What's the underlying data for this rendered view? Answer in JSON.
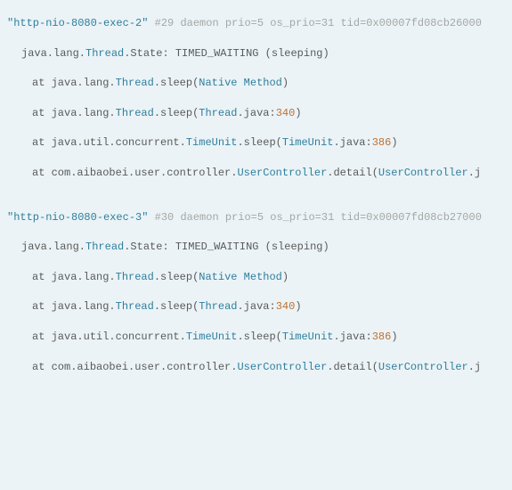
{
  "threads": [
    {
      "name_quoted": "\"http-nio-8080-exec-2\"",
      "meta": "#29 daemon prio=5 os_prio=31 tid=0x00007fd08cb26000",
      "state_prefix_pkg": "java.lang.",
      "state_prefix_cls": "Thread",
      "state_prefix_tail": ".State:",
      "state_value": "TIMED_WAITING (sleeping)",
      "frames": [
        {
          "at": "at ",
          "pkg": "java.lang.",
          "cls": "Thread",
          "method": ".sleep",
          "open": "(",
          "file": "Native Method",
          "colon": "",
          "line": "",
          "close": ")"
        },
        {
          "at": "at ",
          "pkg": "java.lang.",
          "cls": "Thread",
          "method": ".sleep",
          "open": "(",
          "file": "Thread",
          "tail": ".java:",
          "line": "340",
          "close": ")"
        },
        {
          "at": "at ",
          "pkg": "java.util.concurrent.",
          "cls": "TimeUnit",
          "method": ".sleep",
          "open": "(",
          "file": "TimeUnit",
          "tail": ".java:",
          "line": "386",
          "close": ")"
        },
        {
          "at": "at ",
          "pkg": "com.aibaobei.user.controller.",
          "cls": "UserController",
          "method": ".detail",
          "open": "(",
          "file": "UserController",
          "tail": ".j",
          "line": "",
          "close": ""
        }
      ]
    },
    {
      "name_quoted": "\"http-nio-8080-exec-3\"",
      "meta": "#30 daemon prio=5 os_prio=31 tid=0x00007fd08cb27000",
      "state_prefix_pkg": "java.lang.",
      "state_prefix_cls": "Thread",
      "state_prefix_tail": ".State:",
      "state_value": "TIMED_WAITING (sleeping)",
      "frames": [
        {
          "at": "at ",
          "pkg": "java.lang.",
          "cls": "Thread",
          "method": ".sleep",
          "open": "(",
          "file": "Native Method",
          "colon": "",
          "line": "",
          "close": ")"
        },
        {
          "at": "at ",
          "pkg": "java.lang.",
          "cls": "Thread",
          "method": ".sleep",
          "open": "(",
          "file": "Thread",
          "tail": ".java:",
          "line": "340",
          "close": ")"
        },
        {
          "at": "at ",
          "pkg": "java.util.concurrent.",
          "cls": "TimeUnit",
          "method": ".sleep",
          "open": "(",
          "file": "TimeUnit",
          "tail": ".java:",
          "line": "386",
          "close": ")"
        },
        {
          "at": "at ",
          "pkg": "com.aibaobei.user.controller.",
          "cls": "UserController",
          "method": ".detail",
          "open": "(",
          "file": "UserController",
          "tail": ".j",
          "line": "",
          "close": ""
        }
      ]
    }
  ]
}
